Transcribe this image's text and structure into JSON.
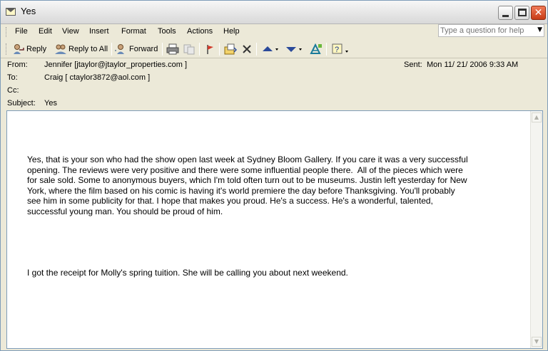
{
  "window": {
    "title": "Yes"
  },
  "menu": {
    "items": [
      "File",
      "Edit",
      "View",
      "Insert",
      "Format",
      "Tools",
      "Actions",
      "Help"
    ],
    "ask_placeholder": "Type a question for help"
  },
  "toolbar": {
    "reply": "Reply",
    "reply_all": "Reply to All",
    "forward": "Forward",
    "icons": [
      "print-icon",
      "copy-icon",
      "flag-icon",
      "move-to-folder-icon",
      "delete-icon",
      "previous-item-icon",
      "next-item-icon",
      "address-book-icon",
      "help-icon"
    ]
  },
  "header": {
    "from_label": "From:",
    "from_value": "Jennifer [jtaylor@jtaylor_properties.com ]",
    "to_label": "To:",
    "to_value": "Craig [ ctaylor3872@aol.com ]",
    "cc_label": "Cc:",
    "cc_value": "",
    "subject_label": "Subject:",
    "subject_value": "Yes",
    "sent_label": "Sent:",
    "sent_value": "Mon  11/ 21/ 2006 9:33 AM"
  },
  "message": {
    "paragraphs": [
      "Yes, that is your son who had the show open last week at Sydney Bloom Gallery. If you care it was a very successful\nopening. The reviews were very positive and there were some influential people there.  All of the pieces which were\nfor sale sold. Some to anonymous buyers, which I'm told often turn out to be museums. Justin left yesterday for New\nYork, where the film based on his comic is having it's world premiere the day before Thanksgiving. You'll probably\nsee him in some publicity for that. I hope that makes you proud. He's a success. He's a wonderful, talented,\nsuccessful young man. You should be proud of him.",
      "I got the receipt for Molly's spring tuition. She will be calling you about next weekend."
    ]
  },
  "colors": {
    "titlebar": "#e4e4e4",
    "close_button": "#d9532f",
    "chrome": "#ece9d8",
    "border": "#7f9db9"
  }
}
